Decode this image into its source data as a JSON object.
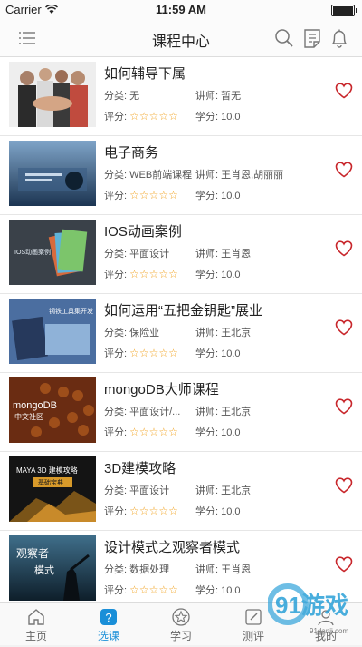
{
  "status": {
    "carrier": "Carrier",
    "time": "11:59 AM"
  },
  "nav": {
    "title": "课程中心",
    "icons": [
      "menu-icon",
      "search-icon",
      "notes-icon",
      "bell-icon"
    ]
  },
  "labels": {
    "category": "分类:",
    "teacher": "讲师:",
    "rating": "评分:",
    "credit": "学分:"
  },
  "courses": [
    {
      "title": "如何辅导下属",
      "category": "无",
      "teacher": "暂无",
      "stars": "☆☆☆☆☆",
      "credit": "10.0"
    },
    {
      "title": "电子商务",
      "category": "WEB前端课程",
      "teacher": "王肖恩,胡丽丽",
      "stars": "☆☆☆☆☆",
      "credit": "10.0"
    },
    {
      "title": "IOS动画案例",
      "category": "平面设计",
      "teacher": "王肖恩",
      "stars": "☆☆☆☆☆",
      "credit": "10.0"
    },
    {
      "title": "如何运用“五把金钥匙”展业",
      "category": "保险业",
      "teacher": "王北京",
      "stars": "☆☆☆☆☆",
      "credit": "10.0"
    },
    {
      "title": "mongoDB大师课程",
      "category": "平面设计/...",
      "teacher": "王北京",
      "stars": "☆☆☆☆☆",
      "credit": "10.0"
    },
    {
      "title": "3D建模攻略",
      "category": "平面设计",
      "teacher": "王北京",
      "stars": "☆☆☆☆☆",
      "credit": "10.0"
    },
    {
      "title": "设计模式之观察者模式",
      "category": "数据处理",
      "teacher": "王肖恩",
      "stars": "☆☆☆☆☆",
      "credit": "10.0"
    }
  ],
  "thumbnails": {
    "ios": "IOS动画案例",
    "insurance": "钢铁工具集开发",
    "mongo_logo": "mongoDB",
    "mongo_sub": "中文社区",
    "maya": "MAYA 3D 建模攻略",
    "maya_sub": "基础宝典",
    "observer_1": "观察者",
    "observer_2": "模式"
  },
  "tabs": [
    {
      "label": "主页",
      "icon": "home-icon",
      "active": false
    },
    {
      "label": "选课",
      "icon": "help-icon",
      "active": true
    },
    {
      "label": "学习",
      "icon": "star-icon",
      "active": false
    },
    {
      "label": "测评",
      "icon": "edit-icon",
      "active": false
    },
    {
      "label": "我的",
      "icon": "profile-icon",
      "active": false
    }
  ],
  "watermark": {
    "text": "91游戏",
    "sub": "91danji.com"
  },
  "colors": {
    "accent": "#1a8fd8",
    "star": "#f1a21e",
    "heart": "#c8262b"
  }
}
